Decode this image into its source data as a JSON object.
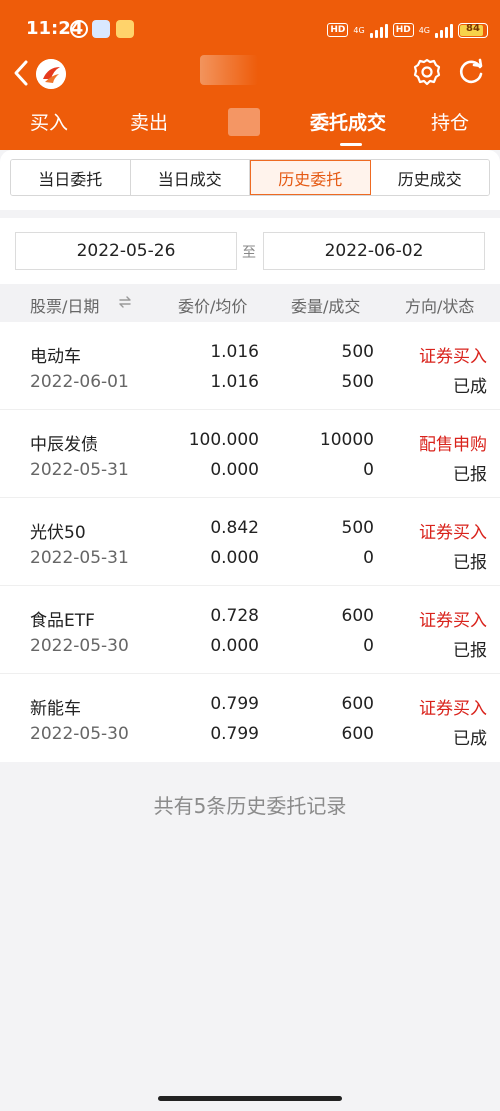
{
  "status_bar": {
    "time": "11:24",
    "net_1": "4G",
    "net_2": "4G",
    "hd_1": "HD",
    "hd_2": "HD",
    "battery": "84"
  },
  "tabs": [
    {
      "label": "买入"
    },
    {
      "label": "卖出"
    },
    {
      "label": "委托成交"
    },
    {
      "label": "持仓"
    }
  ],
  "segments": [
    {
      "label": "当日委托"
    },
    {
      "label": "当日成交"
    },
    {
      "label": "历史委托"
    },
    {
      "label": "历史成交"
    }
  ],
  "active_segment": "历史委托",
  "date_range": {
    "start": "2022-05-26",
    "separator": "至",
    "end": "2022-06-02"
  },
  "table_header": {
    "col_stock_date": "股票/日期",
    "col_price": "委价/均价",
    "col_qty": "委量/成交",
    "col_direction": "方向/状态"
  },
  "orders": [
    {
      "name": "电动车",
      "date": "2022-06-01",
      "price": "1.016",
      "avg_price": "1.016",
      "qty": "500",
      "filled": "500",
      "direction": "证券买入",
      "status": "已成"
    },
    {
      "name": "中辰发债",
      "date": "2022-05-31",
      "price": "100.000",
      "avg_price": "0.000",
      "qty": "10000",
      "filled": "0",
      "direction": "配售申购",
      "status": "已报"
    },
    {
      "name": "光伏50",
      "date": "2022-05-31",
      "price": "0.842",
      "avg_price": "0.000",
      "qty": "500",
      "filled": "0",
      "direction": "证券买入",
      "status": "已报"
    },
    {
      "name": "食品ETF",
      "date": "2022-05-30",
      "price": "0.728",
      "avg_price": "0.000",
      "qty": "600",
      "filled": "0",
      "direction": "证券买入",
      "status": "已报"
    },
    {
      "name": "新能车",
      "date": "2022-05-30",
      "price": "0.799",
      "avg_price": "0.799",
      "qty": "600",
      "filled": "600",
      "direction": "证券买入",
      "status": "已成"
    }
  ],
  "footer_note": "共有5条历史委托记录",
  "colors": {
    "brand": "#ee5c0a",
    "buy_text": "#d9231c",
    "active_segment": "#e55a14"
  },
  "icons": {
    "back": "chevron-left-icon",
    "logo": "app-logo-icon",
    "settings": "gear-icon",
    "refresh": "refresh-icon",
    "sort": "swap-icon"
  }
}
